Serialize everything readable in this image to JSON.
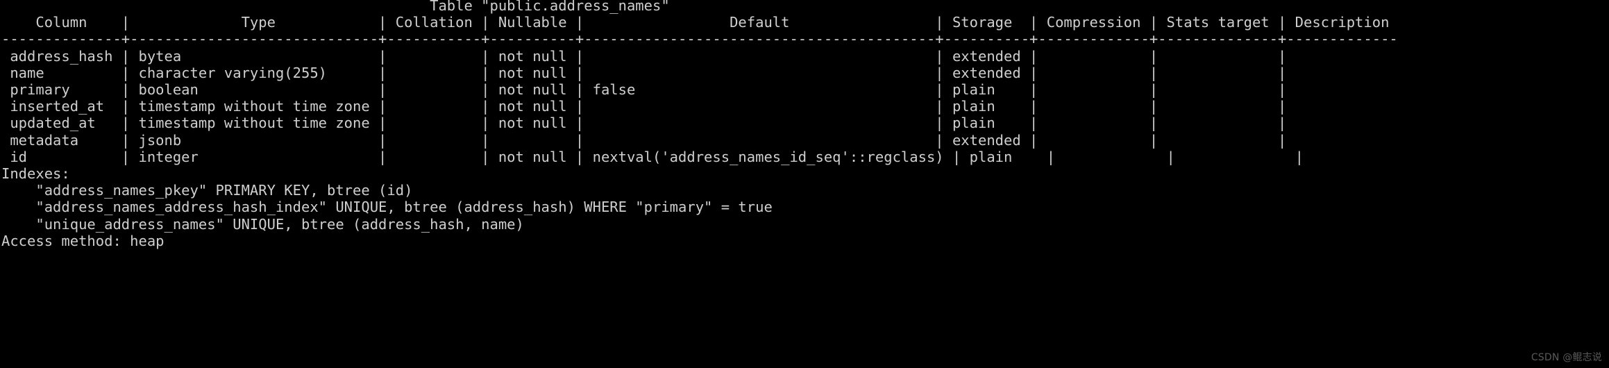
{
  "terminal": {
    "background_color": "#000000",
    "foreground_color": "#cfcfcf",
    "title": "Table \"public.address_names\"",
    "table": {
      "headers": [
        "Column",
        "Type",
        "Collation",
        "Nullable",
        "Default",
        "Storage",
        "Compression",
        "Stats target",
        "Description"
      ],
      "rows": [
        {
          "column": "address_hash",
          "type": "bytea",
          "collation": "",
          "nullable": "not null",
          "default": "",
          "storage": "extended",
          "compression": "",
          "stats_target": "",
          "description": ""
        },
        {
          "column": "name",
          "type": "character varying(255)",
          "collation": "",
          "nullable": "not null",
          "default": "",
          "storage": "extended",
          "compression": "",
          "stats_target": "",
          "description": ""
        },
        {
          "column": "primary",
          "type": "boolean",
          "collation": "",
          "nullable": "not null",
          "default": "false",
          "storage": "plain",
          "compression": "",
          "stats_target": "",
          "description": ""
        },
        {
          "column": "inserted_at",
          "type": "timestamp without time zone",
          "collation": "",
          "nullable": "not null",
          "default": "",
          "storage": "plain",
          "compression": "",
          "stats_target": "",
          "description": ""
        },
        {
          "column": "updated_at",
          "type": "timestamp without time zone",
          "collation": "",
          "nullable": "not null",
          "default": "",
          "storage": "plain",
          "compression": "",
          "stats_target": "",
          "description": ""
        },
        {
          "column": "metadata",
          "type": "jsonb",
          "collation": "",
          "nullable": "",
          "default": "",
          "storage": "extended",
          "compression": "",
          "stats_target": "",
          "description": ""
        },
        {
          "column": "id",
          "type": "integer",
          "collation": "",
          "nullable": "not null",
          "default": "nextval('address_names_id_seq'::regclass)",
          "storage": "plain",
          "compression": "",
          "stats_target": "",
          "description": ""
        }
      ]
    },
    "indexes_label": "Indexes:",
    "indexes": [
      "\"address_names_pkey\" PRIMARY KEY, btree (id)",
      "\"address_names_address_hash_index\" UNIQUE, btree (address_hash) WHERE \"primary\" = true",
      "\"unique_address_names\" UNIQUE, btree (address_hash, name)"
    ],
    "access_method_line": "Access method: heap",
    "raw_output": "                                                  Table \"public.address_names\"\n    Column    |             Type            | Collation | Nullable |                 Default                 | Storage  | Compression | Stats target | Description \n--------------+-----------------------------+-----------+----------+-----------------------------------------+----------+-------------+--------------+-------------\n address_hash | bytea                       |           | not null |                                         | extended |             |              | \n name         | character varying(255)      |           | not null |                                         | extended |             |              | \n primary      | boolean                     |           | not null | false                                   | plain    |             |              | \n inserted_at  | timestamp without time zone |           | not null |                                         | plain    |             |              | \n updated_at   | timestamp without time zone |           | not null |                                         | plain    |             |              | \n metadata     | jsonb                       |           |          |                                         | extended |             |              | \n id           | integer                     |           | not null | nextval('address_names_id_seq'::regclass) | plain    |             |              | \nIndexes:\n    \"address_names_pkey\" PRIMARY KEY, btree (id)\n    \"address_names_address_hash_index\" UNIQUE, btree (address_hash) WHERE \"primary\" = true\n    \"unique_address_names\" UNIQUE, btree (address_hash, name)\nAccess method: heap"
  },
  "watermark": {
    "text": "CSDN @鲲志说"
  }
}
